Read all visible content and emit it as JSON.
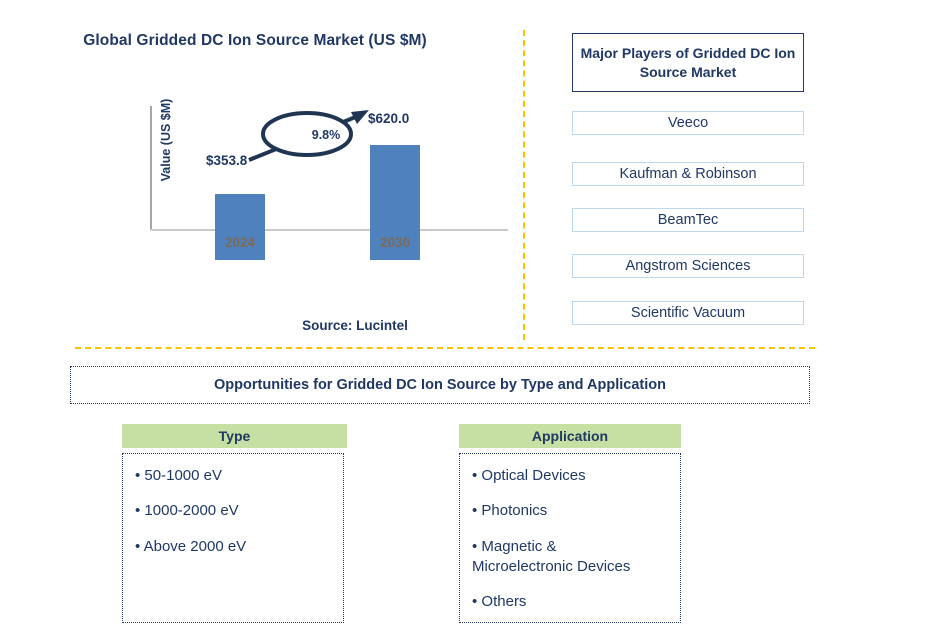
{
  "chart": {
    "title": "Global Gridded DC Ion Source Market (US $M)",
    "source_note": "Source: Lucintel"
  },
  "chart_data": {
    "type": "bar",
    "title": "Global Gridded DC Ion Source Market (US $M)",
    "categories": [
      "2024",
      "2030"
    ],
    "values": [
      353.8,
      620.0
    ],
    "value_labels": [
      "$353.8",
      "$620.0"
    ],
    "xlabel": "",
    "ylabel": "Value (US $M)",
    "ylim": [
      0,
      700
    ],
    "grid": false,
    "legend": false,
    "annotations": [
      {
        "type": "cagr-callout",
        "label": "9.8%",
        "from_category": "2024",
        "to_category": "2030"
      }
    ],
    "series_color": "#4F81BD",
    "source": "Source: Lucintel"
  },
  "players_panel": {
    "header": "Major Players of Gridded DC Ion Source Market",
    "items": [
      {
        "label": "Veeco"
      },
      {
        "label": "Kaufman & Robinson"
      },
      {
        "label": "BeamTec"
      },
      {
        "label": "Angstrom Sciences"
      },
      {
        "label": "Scientific Vacuum"
      }
    ]
  },
  "opportunities": {
    "banner": "Opportunities for Gridded DC Ion Source by Type and Application",
    "columns": [
      {
        "header": "Type",
        "items": [
          "• 50-1000 eV",
          "• 1000-2000 eV",
          "• Above 2000 eV"
        ]
      },
      {
        "header": "Application",
        "items": [
          "• Optical Devices",
          "• Photonics",
          "• Magnetic &\n   Microelectronic Devices",
          "• Others"
        ]
      }
    ]
  },
  "colors": {
    "navy": "#1F3864",
    "bar_blue": "#4F81BD",
    "green_header": "#C6E0A4",
    "divider_orange": "#FFC000",
    "light_blue_border": "#BDD7EE"
  }
}
